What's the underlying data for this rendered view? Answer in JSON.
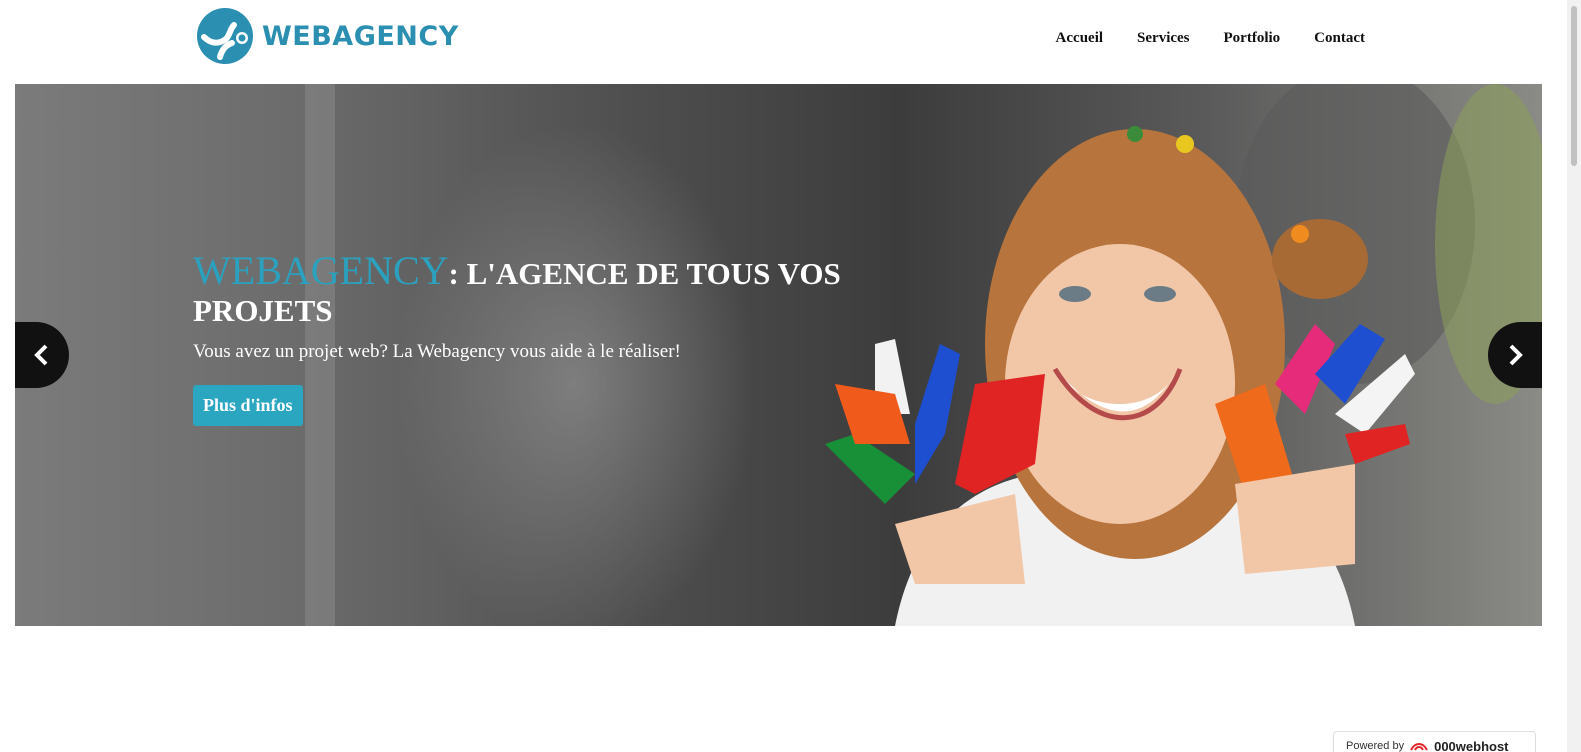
{
  "header": {
    "brand": "WEBAGENCY",
    "nav": [
      "Accueil",
      "Services",
      "Portfolio",
      "Contact"
    ]
  },
  "hero": {
    "brand": "WEBAGENCY",
    "title_rest": ": L'AGENCE DE TOUS VOS PROJETS",
    "text": "Vous avez un projet web? La Webagency vous aide à le réaliser!",
    "button": "Plus d'infos",
    "image": "girl-with-painted-hands"
  },
  "badge": {
    "label": "Powered by",
    "provider": "000webhost"
  },
  "colors": {
    "accent": "#2ba6c1",
    "brand": "#2a8fb0"
  }
}
